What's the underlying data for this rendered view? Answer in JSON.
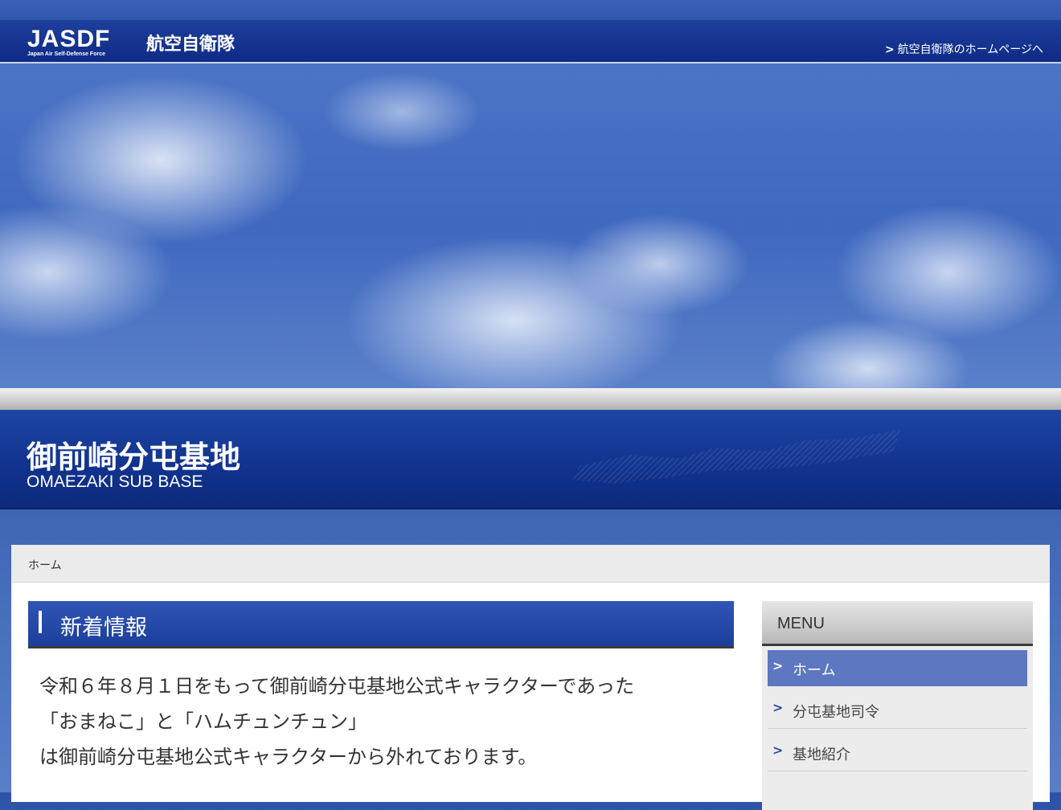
{
  "header": {
    "logo_text": "JASDF",
    "logo_subtext": "Japan Air Self-Defense Force",
    "org_name_jp": "航空自衛隊",
    "home_link": "航空自衛隊のホームページへ"
  },
  "banner": {
    "title": "御前崎分屯基地",
    "subtitle": "OMAEZAKI SUB BASE"
  },
  "breadcrumb": {
    "current": "ホーム"
  },
  "news": {
    "heading": "新着情報",
    "lines": [
      "令和６年８月１日をもって御前崎分屯基地公式キャラクターであった",
      "「おまねこ」と「ハムチュンチュン」",
      "は御前崎分屯基地公式キャラクターから外れております。"
    ]
  },
  "menu": {
    "heading": "MENU",
    "items": [
      {
        "label": "ホーム",
        "active": true
      },
      {
        "label": "分屯基地司令",
        "active": false
      },
      {
        "label": "基地紹介",
        "active": false
      }
    ]
  },
  "icons": {
    "link_chevron": "chevron-right-icon"
  },
  "colors": {
    "header_blue": "#0e2b86",
    "accent_blue": "#1c3f9b",
    "menu_active": "#5d77c0"
  }
}
